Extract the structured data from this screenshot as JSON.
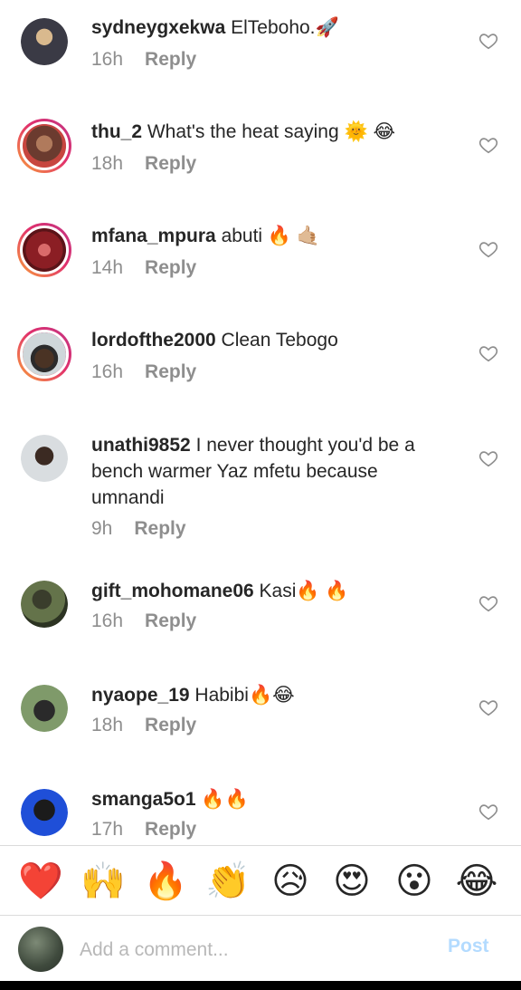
{
  "comments": [
    {
      "username": "sydneygxekwa",
      "text": "ElTeboho.🚀",
      "time": "16h",
      "reply": "Reply"
    },
    {
      "username": "thu_2",
      "text": "What's the heat saying 🌞 😂",
      "time": "18h",
      "reply": "Reply"
    },
    {
      "username": "mfana_mpura",
      "text": "abuti 🔥 🤙🏼",
      "time": "14h",
      "reply": "Reply"
    },
    {
      "username": "lordofthe2000",
      "text": "Clean Tebogo",
      "time": "16h",
      "reply": "Reply"
    },
    {
      "username": "unathi9852",
      "text": "I never thought you'd be a bench warmer Yaz mfetu because umnandi",
      "time": "9h",
      "reply": "Reply"
    },
    {
      "username": "gift_mohomane06",
      "text": "Kasi🔥 🔥",
      "time": "16h",
      "reply": "Reply"
    },
    {
      "username": "nyaope_19",
      "text": "Habibi🔥😂",
      "time": "18h",
      "reply": "Reply"
    },
    {
      "username": "smanga5o1",
      "text": "🔥🔥",
      "time": "17h",
      "reply": "Reply"
    }
  ],
  "reactions": [
    "❤️",
    "🙌",
    "🔥",
    "👏",
    "😥",
    "😍",
    "😮",
    "😂"
  ],
  "composer": {
    "placeholder": "Add a comment...",
    "post_label": "Post"
  },
  "colors": {
    "muted_text": "#8e8e8e",
    "post_disabled": "#b3dbff",
    "story_ring_start": "#f9a13a",
    "story_ring_end": "#c13584"
  }
}
